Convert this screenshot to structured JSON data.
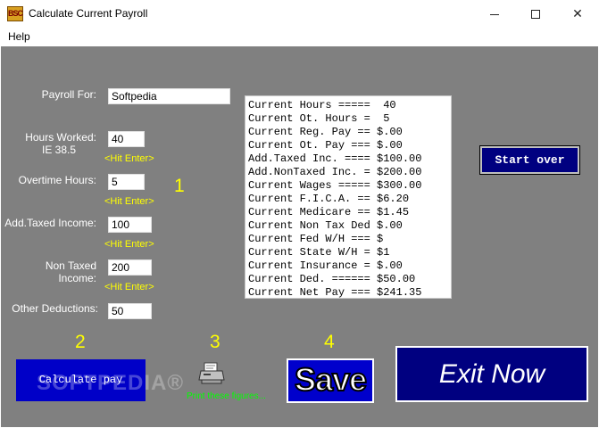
{
  "window": {
    "title": "Calculate Current Payroll",
    "icon_name": "bsc-app-icon",
    "icon_text": "BSC",
    "controls": [
      "minimize-icon",
      "maximize-icon",
      "close-icon"
    ],
    "close_glyph": "✕"
  },
  "menu": {
    "help": "Help"
  },
  "form": {
    "payroll_for_label": "Payroll For:",
    "payroll_for_value": "Softpedia",
    "hours_worked_label": "Hours Worked:",
    "hours_worked_sub": "IE 38.5",
    "hours_worked_value": "40",
    "overtime_label": "Overtime Hours:",
    "overtime_value": "5",
    "add_taxed_label": "Add.Taxed Income:",
    "add_taxed_value": "100",
    "non_taxed_label": "Non Taxed Income:",
    "non_taxed_value": "200",
    "other_deductions_label": "Other Deductions:",
    "other_deductions_value": "50",
    "hint": "<Hit Enter>"
  },
  "steps": {
    "one": "1",
    "two": "2",
    "three": "3",
    "four": "4"
  },
  "results": [
    "Current Hours =====  40",
    "Current Ot. Hours =  5",
    "Current Reg. Pay == $.00",
    "Current Ot. Pay === $.00",
    "Add.Taxed Inc. ==== $100.00",
    "Add.NonTaxed Inc. = $200.00",
    "Current Wages ===== $300.00",
    "Current F.I.C.A. == $6.20",
    "Current Medicare == $1.45",
    "Current Non Tax Ded $.00",
    "Current Fed W/H === $",
    "Current State W/H = $1",
    "Current Insurance = $.00",
    "Current Ded. ====== $50.00",
    "Current Net Pay === $241.35"
  ],
  "buttons": {
    "start_over": "Start over",
    "calculate_pay": "Calculate pay",
    "print_text": "Print these figures...",
    "save": "Save",
    "exit": "Exit Now"
  },
  "watermark": "SOFTPEDIA®",
  "colors": {
    "background": "#808080",
    "hint_yellow": "#ffff00",
    "button_navy": "#000080",
    "calc_blue": "#0000c8",
    "print_green": "#00ff00"
  }
}
